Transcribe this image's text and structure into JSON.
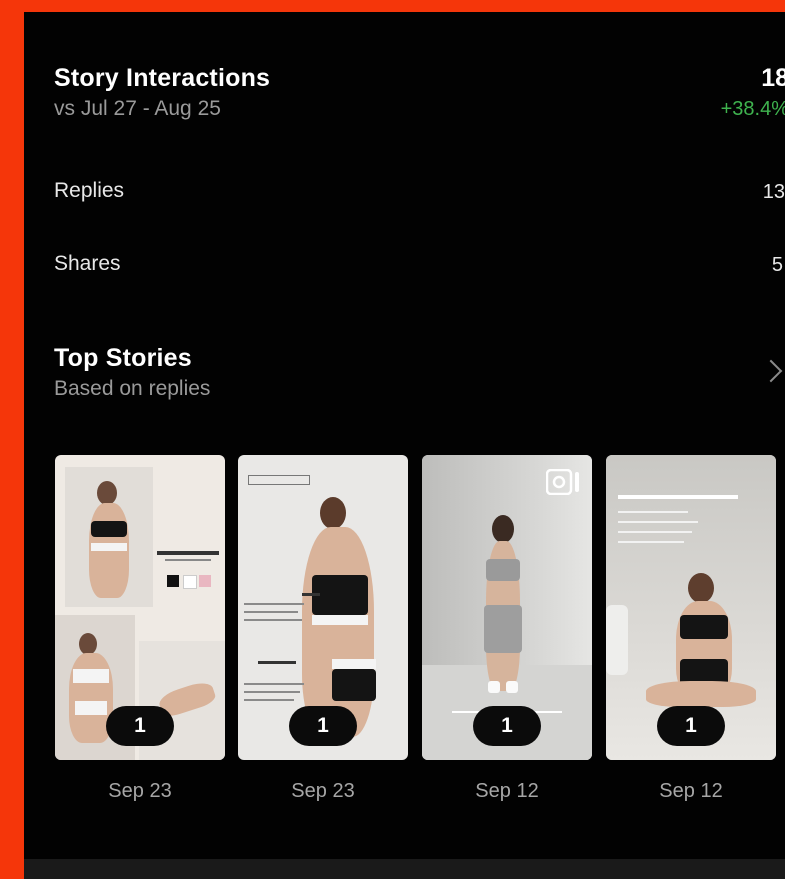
{
  "interactions": {
    "title": "Story Interactions",
    "comparison": "vs Jul 27 - Aug 25",
    "total": "18",
    "change": "+38.4%"
  },
  "metrics": [
    {
      "label": "Replies",
      "value": "13"
    },
    {
      "label": "Shares",
      "value": "5"
    }
  ],
  "top_stories": {
    "title": "Top Stories",
    "subtitle": "Based on replies",
    "items": [
      {
        "count": "1",
        "date": "Sep 23"
      },
      {
        "count": "1",
        "date": "Sep 23"
      },
      {
        "count": "1",
        "date": "Sep 12"
      },
      {
        "count": "1",
        "date": "Sep 12"
      }
    ]
  },
  "colors": {
    "frame": "#f5360a",
    "background": "#020202",
    "positive": "#3fb34f"
  },
  "icons": [
    "chevron-right-icon",
    "video-camera-icon"
  ]
}
